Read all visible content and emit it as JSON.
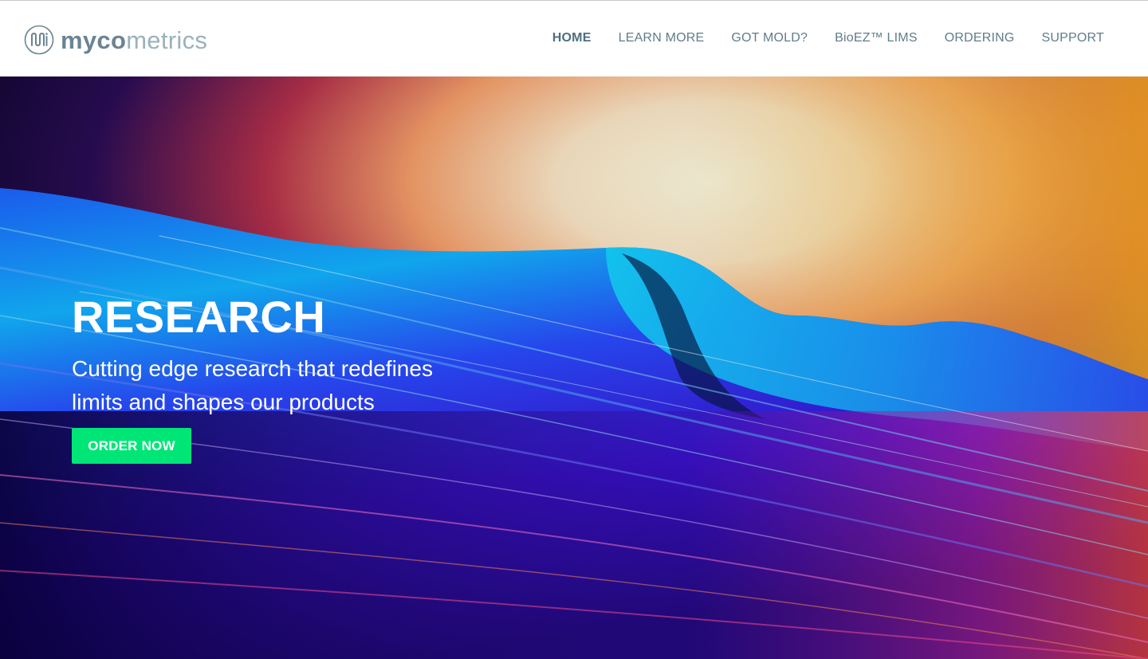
{
  "brand": {
    "name_bold": "myco",
    "name_light": "metrics",
    "logo_icon": "mycometrics-logo-icon",
    "colors": {
      "bold": "#6a8493",
      "light": "#9bb1bd"
    }
  },
  "nav": {
    "items": [
      {
        "label": "HOME",
        "active": true
      },
      {
        "label": "LEARN MORE",
        "active": false
      },
      {
        "label": "GOT MOLD?",
        "active": false
      },
      {
        "label": "BioEZ™  LIMS",
        "active": false
      },
      {
        "label": "ORDERING",
        "active": false
      },
      {
        "label": "SUPPORT",
        "active": false
      }
    ]
  },
  "hero": {
    "title": "RESEARCH",
    "subtitle": "Cutting edge research that redefines limits and shapes our products",
    "cta_label": "ORDER NOW",
    "background_image": "ocean-wave-sunset",
    "colors": {
      "cta": "#00e676"
    }
  }
}
